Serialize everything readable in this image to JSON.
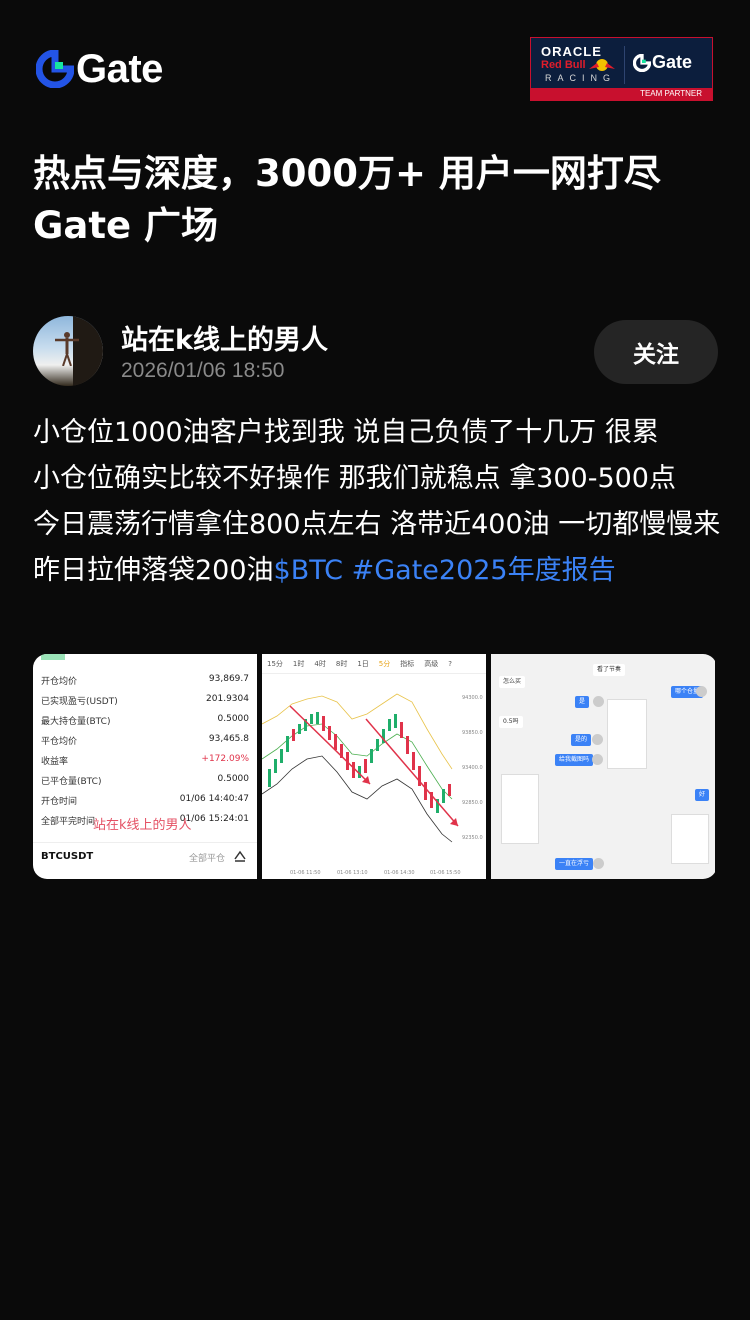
{
  "brand": {
    "logo_text": "Gate",
    "accent": "#2354e6"
  },
  "partner_badge": {
    "oracle": "ORACLE",
    "redbull": "Red Bull",
    "racing": "RACING",
    "gate": "Gate",
    "team_partner": "TEAM PARTNER"
  },
  "headline": {
    "line1": "热点与深度，3000万+ 用户一网打尽",
    "line2": "Gate 广场"
  },
  "post": {
    "author_name": "站在k线上的男人",
    "timestamp": "2026/01/06 18:50",
    "follow_label": "关注",
    "body_line1": "小仓位1000油客户找到我 说自己负债了十几万 很累",
    "body_line2": "小仓位确实比较不好操作 那我们就稳点 拿300-500点",
    "body_line3": "今日震荡行情拿住800点左右 洛带近400油 一切都慢慢来 昨日拉伸落袋200油",
    "tag_btc": "$BTC",
    "tag_report": "#Gate2025年度报告",
    "tag_color": "#3b82f6"
  },
  "image1": {
    "rows": [
      {
        "label": "开仓均价",
        "value": "93,869.7"
      },
      {
        "label": "已实现盈亏(USDT)",
        "value": "201.9304"
      },
      {
        "label": "最大持仓量(BTC)",
        "value": "0.5000"
      },
      {
        "label": "平仓均价",
        "value": "93,465.8"
      },
      {
        "label": "收益率",
        "value": "+172.09%"
      },
      {
        "label": "已平仓量(BTC)",
        "value": "0.5000"
      },
      {
        "label": "开仓时间",
        "value": "01/06 14:40:47"
      },
      {
        "label": "全部平完时间",
        "value": "01/06 15:24:01"
      }
    ],
    "watermark": "站在k线上的男人",
    "symbol": "BTCUSDT",
    "action": "全部平仓"
  },
  "image2": {
    "intervals": [
      "15分",
      "1时",
      "4时",
      "8时",
      "1日",
      "5分",
      "指标",
      "高级",
      "?"
    ],
    "active_interval": "5分"
  },
  "image3": {
    "messages": [
      "看了节奏",
      "怎么买",
      "哪个仓量",
      "是",
      "0.5吗",
      "是的",
      "给我截图吗",
      "好",
      "一直在浮亏"
    ]
  }
}
